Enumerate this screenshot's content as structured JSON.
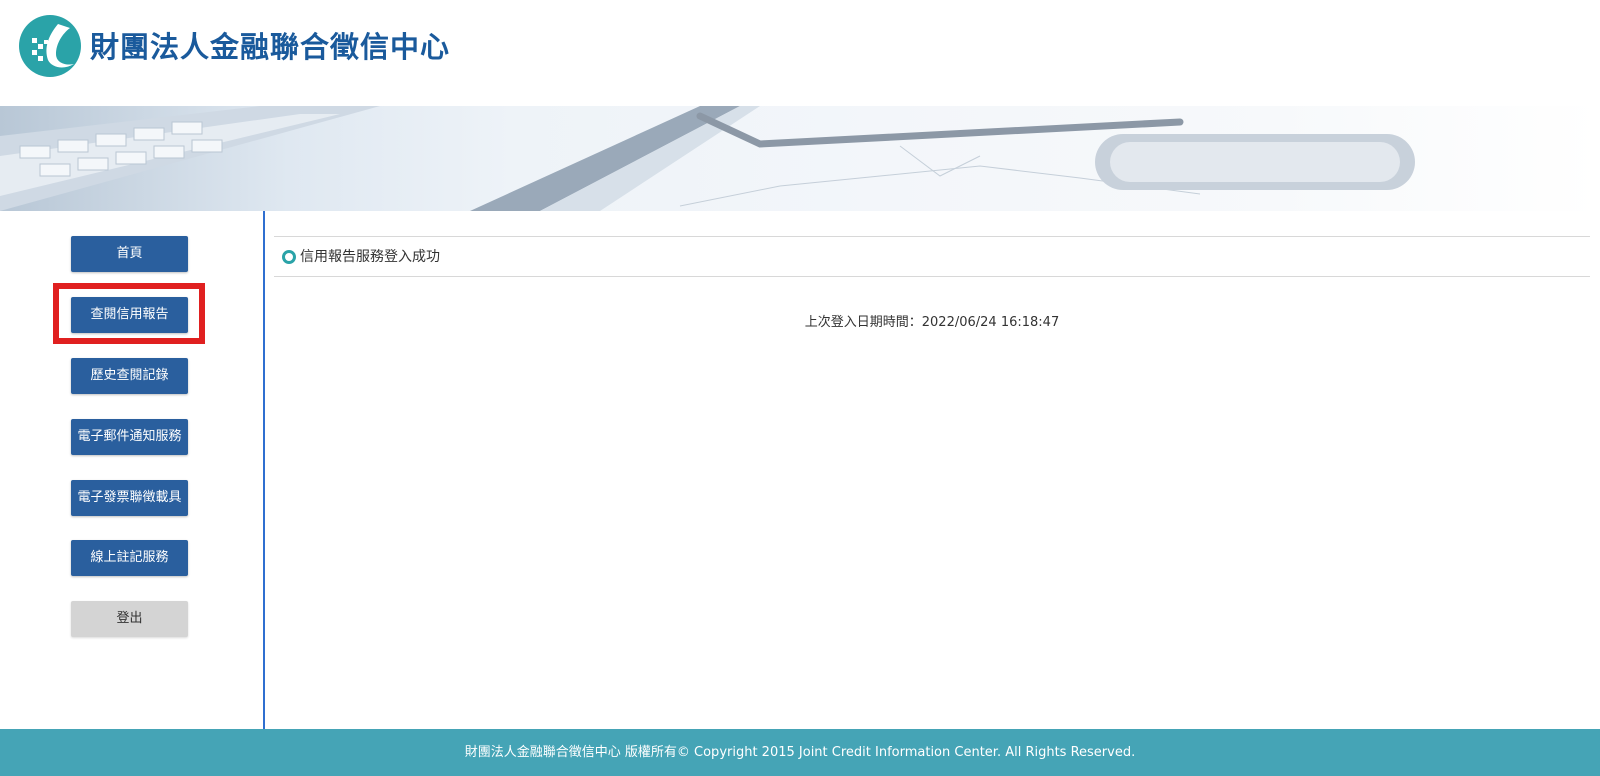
{
  "header": {
    "site_title": "財團法人金融聯合徵信中心"
  },
  "sidebar": {
    "items": [
      {
        "label": "首頁"
      },
      {
        "label": "查閱信用報告"
      },
      {
        "label": "歷史查閱記錄"
      },
      {
        "label": "電子郵件通知服務"
      },
      {
        "label": "電子發票聯徵載具"
      },
      {
        "label": "線上註記服務"
      },
      {
        "label": "登出"
      }
    ]
  },
  "main": {
    "section_title": "信用報告服務登入成功",
    "last_login": "上次登入日期時間：2022/06/24 16:18:47"
  },
  "footer": {
    "copyright": "財團法人金融聯合徵信中心 版權所有© Copyright 2015 Joint Credit Information Center. All Rights Reserved."
  },
  "colors": {
    "nav_button": "#2a5f9e",
    "logout_button": "#d4d4d4",
    "footer_bg": "#45a4b6",
    "title_blue": "#1a5a9c",
    "highlight": "#e02020",
    "divider": "#2f6fd0"
  },
  "icons": {
    "logo": "jcic-logo-icon",
    "bullet": "circle-bullet-icon"
  }
}
